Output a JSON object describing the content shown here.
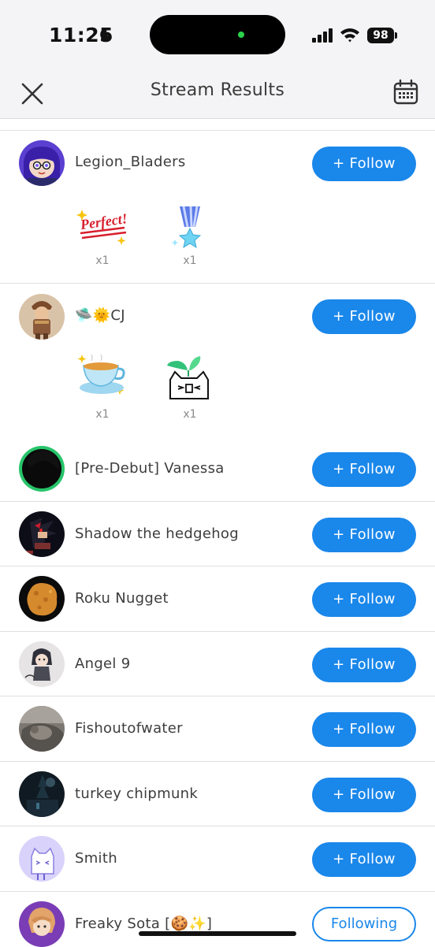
{
  "status": {
    "time": "11:25",
    "battery": "98"
  },
  "header": {
    "title": "Stream Results"
  },
  "rows": [
    {
      "name": "Legion_Bladers",
      "button": "+ Follow",
      "gifts": [
        {
          "icon": "perfect-sticker-icon",
          "text": "Perfect!",
          "count": "x1"
        },
        {
          "icon": "star-medal-icon",
          "count": "x1"
        }
      ]
    },
    {
      "name": "🛸🌞CJ",
      "button": "+ Follow",
      "gifts": [
        {
          "icon": "teacup-icon",
          "count": "x1"
        },
        {
          "icon": "sprout-cat-icon",
          "count": "x1"
        }
      ]
    },
    {
      "name": "[Pre-Debut] Vanessa",
      "button": "+ Follow"
    },
    {
      "name": "Shadow the hedgehog",
      "button": "+ Follow"
    },
    {
      "name": "Roku Nugget",
      "button": "+ Follow"
    },
    {
      "name": "Angel 9",
      "button": "+ Follow"
    },
    {
      "name": "Fishoutofwater",
      "button": "+ Follow"
    },
    {
      "name": "turkey chipmunk",
      "button": "+ Follow"
    },
    {
      "name": "Smith",
      "button": "+ Follow"
    },
    {
      "name": "Freaky Sota [🍪✨]",
      "button": "Following"
    }
  ]
}
